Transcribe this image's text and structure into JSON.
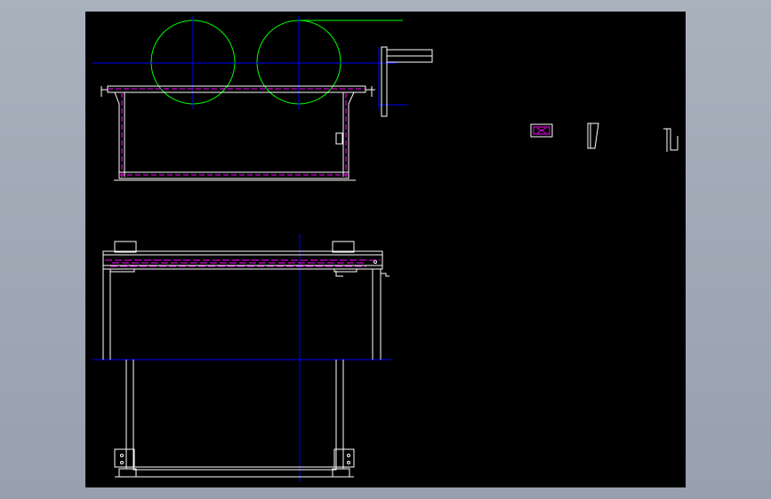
{
  "colors": {
    "background": "#000000",
    "frame": "#98a1ae",
    "outline": "#ffffff",
    "centerline": "#0000ff",
    "hidden": "#ff00ff",
    "roller": "#00ff00"
  },
  "icons": [
    "small-part-icon",
    "wedge-part-icon",
    "bracket-part-icon"
  ]
}
